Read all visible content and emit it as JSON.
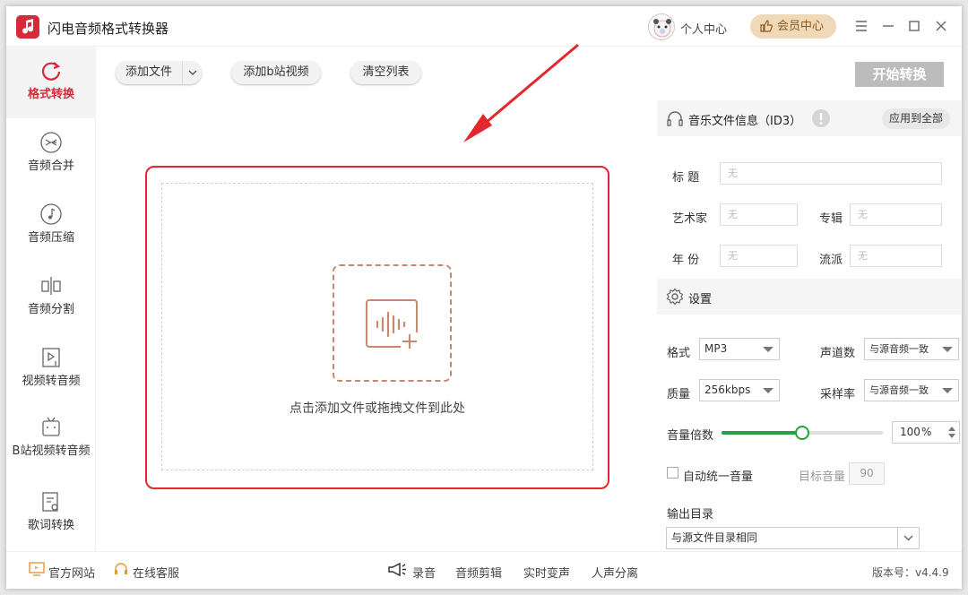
{
  "app": {
    "title": "闪电音频格式转换器",
    "user_center": "个人中心",
    "vip_center": "会员中心"
  },
  "sidebar": {
    "items": [
      {
        "label": "格式转换",
        "icon": "refresh-icon",
        "active": true
      },
      {
        "label": "音频合并",
        "icon": "merge-icon"
      },
      {
        "label": "音频压缩",
        "icon": "music-note-icon"
      },
      {
        "label": "音频分割",
        "icon": "split-icon"
      },
      {
        "label": "视频转音频",
        "icon": "video-audio-icon"
      },
      {
        "label": "B站视频转音频",
        "icon": "bilibili-icon"
      },
      {
        "label": "歌词转换",
        "icon": "lyrics-icon"
      }
    ]
  },
  "toolbar": {
    "add_file": "添加文件",
    "add_bilibili": "添加b站视频",
    "clear_list": "清空列表",
    "start": "开始转换"
  },
  "dropzone": {
    "text": "点击添加文件或拖拽文件到此处"
  },
  "id3": {
    "header": "音乐文件信息（ID3）",
    "apply_all": "应用到全部",
    "title_label": "标 题",
    "title_placeholder": "无",
    "artist_label": "艺术家",
    "artist_placeholder": "无",
    "album_label": "专辑",
    "album_placeholder": "无",
    "year_label": "年 份",
    "year_placeholder": "无",
    "genre_label": "流派",
    "genre_placeholder": "无"
  },
  "settings": {
    "header": "设置",
    "format_label": "格式",
    "format_value": "MP3",
    "channels_label": "声道数",
    "channels_value": "与源音频一致",
    "quality_label": "质量",
    "quality_value": "256kbps",
    "samplerate_label": "采样率",
    "samplerate_value": "与源音频一致",
    "volume_label": "音量倍数",
    "volume_value": "100",
    "volume_unit": "%",
    "volume_fraction": 0.5,
    "auto_volume_label": "自动统一音量",
    "target_volume_label": "目标音量",
    "target_volume_value": "90",
    "output_dir_label": "输出目录",
    "output_dir_value": "与源文件目录相同"
  },
  "footer": {
    "official_site": "官方网站",
    "online_service": "在线客服",
    "record": "录音",
    "audio_edit": "音频剪辑",
    "realtime_voice": "实时变声",
    "vocal_separation": "人声分离",
    "version": "版本号：v4.4.9"
  },
  "colors": {
    "brand_red": "#d6293a",
    "drop_border": "#e4272d",
    "slider_green": "#22a33b",
    "vip_gold": "#f0d9b8"
  }
}
